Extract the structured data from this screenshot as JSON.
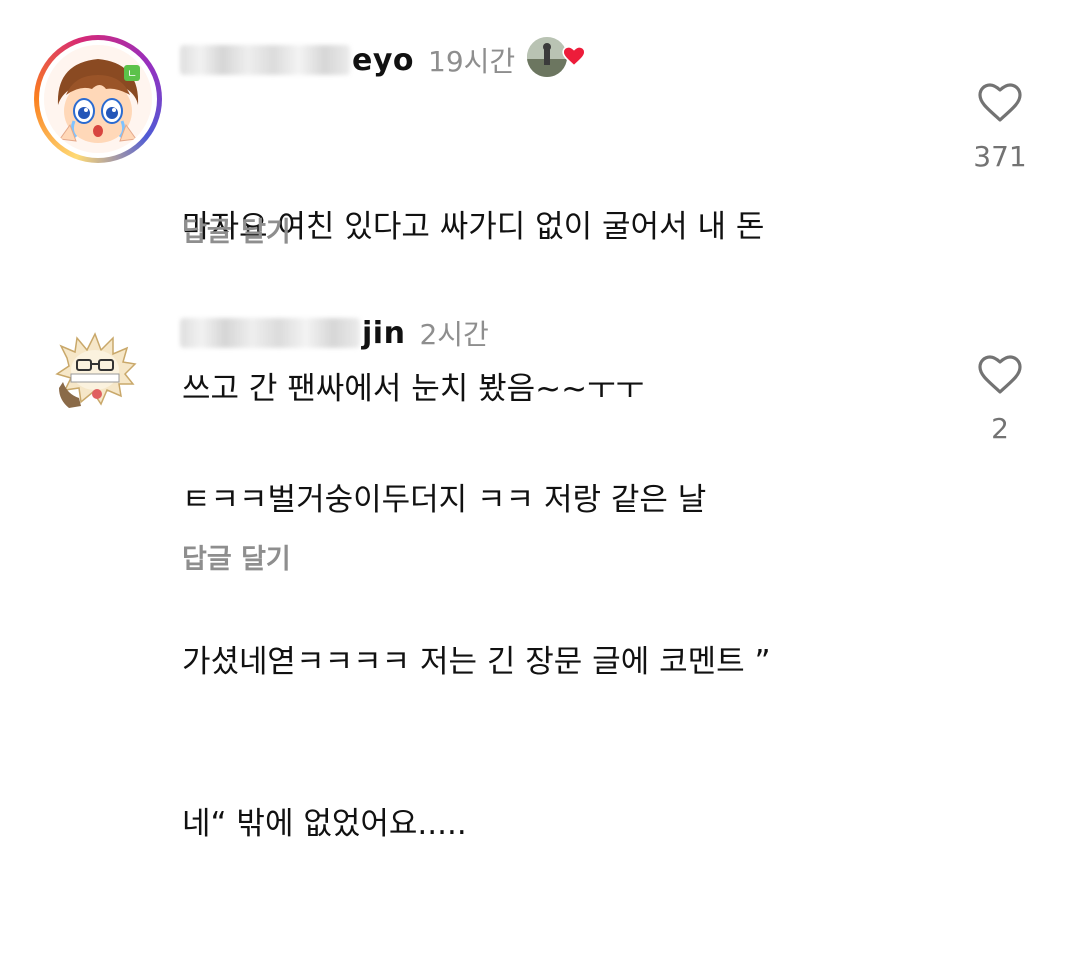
{
  "comments": [
    {
      "username_visible": "eyo",
      "timestamp": "19시간",
      "lines": [
        "마자요 여친 있다고 싸가디 없이 굴어서 내 돈",
        "쓰고 간 팬싸에서 눈치 봤음~~ㅜㅜ"
      ],
      "reply_label": "답글 달기",
      "like_count": "371",
      "liked_by_author": true,
      "avatar_icon": "cartoon-girl-avatar",
      "has_story_ring": true
    },
    {
      "username_visible": "jin",
      "timestamp": "2시간",
      "lines": [
        "ㅌㅋㅋ벌거숭이두더지 ㅋㅋ 저랑 같은 날",
        "가셨네엳ㅋㅋㅋㅋ 저는 긴 장문 글에 코멘트 ”",
        "네“ 밖에 없었어요....."
      ],
      "reply_label": "답글 달기",
      "like_count": "2",
      "liked_by_author": false,
      "avatar_icon": "hedgehog-cartoon-avatar",
      "has_story_ring": false
    }
  ],
  "colors": {
    "text": "#111111",
    "secondary_text": "#8e8e8e",
    "like_count": "#737373",
    "heart_red": "#ed1c3a",
    "heart_outline": "#737373"
  }
}
